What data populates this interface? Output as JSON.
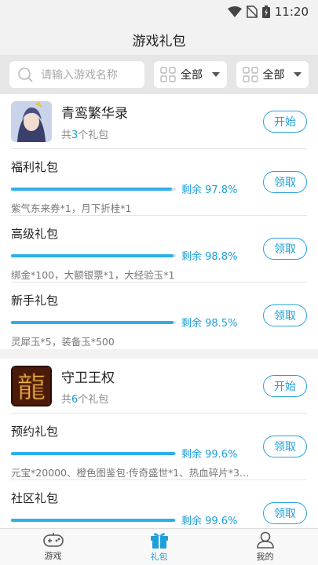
{
  "status": {
    "time": "11:20"
  },
  "title": "游戏礼包",
  "filter": {
    "search_placeholder": "请输入游戏名称",
    "select1": "全部",
    "select2": "全部"
  },
  "games": [
    {
      "name": "青鸾繁华录",
      "count_prefix": "共",
      "count": "3",
      "count_suffix": "个礼包",
      "button": "开始",
      "gifts": [
        {
          "name": "福利礼包",
          "remain": "剩余 97.8%",
          "progress": 0.978,
          "desc": "紫气东来券*1，月下折桂*1",
          "button": "领取"
        },
        {
          "name": "高级礼包",
          "remain": "剩余 98.8%",
          "progress": 0.988,
          "desc": "绑金*100，大额银票*1，大经验玉*1",
          "button": "领取"
        },
        {
          "name": "新手礼包",
          "remain": "剩余 98.5%",
          "progress": 0.985,
          "desc": "灵犀玉*5，装备玉*500",
          "button": "领取"
        }
      ]
    },
    {
      "name": "守卫王权",
      "count_prefix": "共",
      "count": "6",
      "count_suffix": "个礼包",
      "button": "开始",
      "gifts": [
        {
          "name": "预约礼包",
          "remain": "剩余 99.6%",
          "progress": 0.996,
          "desc": "元宝*20000、橙色图鉴包·传奇盛世*1、热血碎片*30...",
          "button": "领取"
        },
        {
          "name": "社区礼包",
          "remain": "剩余 99.6%",
          "progress": 0.996,
          "desc": "",
          "button": "领取"
        }
      ]
    }
  ],
  "nav": [
    {
      "label": "游戏",
      "icon": "gamepad-icon"
    },
    {
      "label": "礼包",
      "icon": "gift-icon"
    },
    {
      "label": "我的",
      "icon": "user-icon"
    }
  ],
  "colors": {
    "accent": "#1e9fd8",
    "progress": "#2bb0ea"
  }
}
